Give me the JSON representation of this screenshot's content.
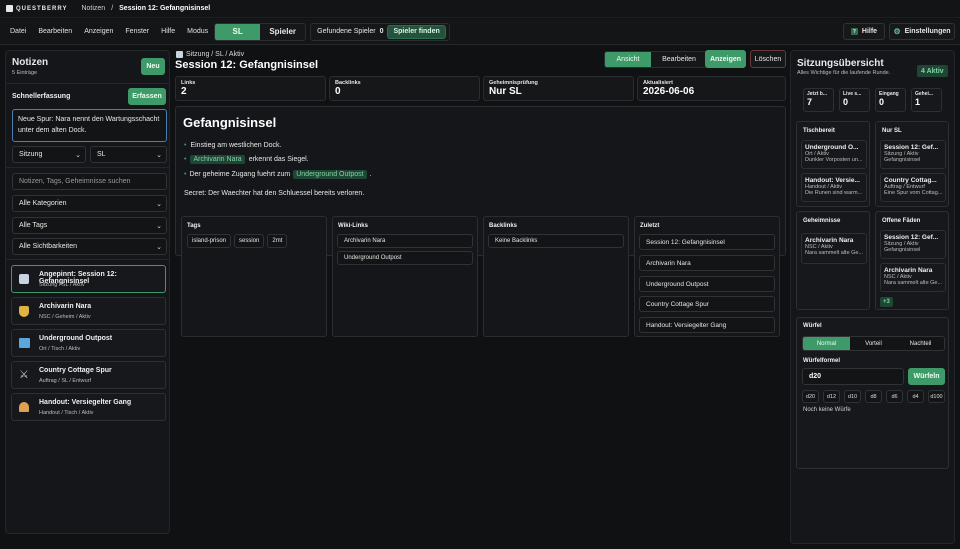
{
  "app": {
    "brand": "QUESTBERRY",
    "crumb_root": "Notizen",
    "crumb_sep": "/",
    "crumb_current": "Session 12: Gefangnisinsel"
  },
  "menubar": {
    "items": [
      "Datei",
      "Bearbeiten",
      "Anzeigen",
      "Fenster",
      "Hilfe",
      "Modus"
    ],
    "mode_sl": "SL",
    "mode_player": "Spieler",
    "found_label": "Gefundene Spieler",
    "found_count": "0",
    "find_button": "Spieler finden",
    "help_button": "Hilfe",
    "settings_button": "Einstellungen"
  },
  "notes": {
    "title": "Notizen",
    "count": "5 Einträge",
    "new_button": "Neu",
    "quick_label": "Schnellerfassung",
    "capture_button": "Erfassen",
    "quick_text": "Neue Spur: Nara nennt den Wartungsschacht unter dem alten Dock.",
    "type_select": "Sitzung",
    "vis_select": "SL",
    "search_placeholder": "Notizen, Tags, Geheimnisse suchen",
    "filter_category": "Alle Kategorien",
    "filter_tags": "Alle Tags",
    "filter_visibility": "Alle Sichtbarkeiten",
    "items": [
      {
        "title": "Angepinnt: Session 12: Gefangnisinsel",
        "meta": "Sitzung / SL / Aktiv",
        "icon": "calendar-icon",
        "color": "#c7d3e0"
      },
      {
        "title": "Archivarin Nara",
        "meta": "NSC / Geheim / Aktiv",
        "icon": "shield-icon",
        "color": "#e3b341"
      },
      {
        "title": "Underground Outpost",
        "meta": "Ort / Tisch / Aktiv",
        "icon": "map-icon",
        "color": "#5aa7e0"
      },
      {
        "title": "Country Cottage Spur",
        "meta": "Auftrag / SL / Entwurf",
        "icon": "crossed-swords-icon",
        "color": "#d0d0d0"
      },
      {
        "title": "Handout: Versiegelter Gang",
        "meta": "Handout / Tisch / Aktiv",
        "icon": "bell-icon",
        "color": "#e0a050"
      }
    ]
  },
  "detail": {
    "path": "Sitzung / SL / Aktiv",
    "title": "Session 12: Gefangnisinsel",
    "tab_view": "Ansicht",
    "tab_edit": "Bearbeiten",
    "show_button": "Anzeigen",
    "delete_button": "Löschen",
    "stats": [
      {
        "label": "Links",
        "value": "2"
      },
      {
        "label": "Backlinks",
        "value": "0"
      },
      {
        "label": "Geheimnisprüfung",
        "value": "Nur SL"
      },
      {
        "label": "Aktualisiert",
        "value": "2026-06-06"
      }
    ],
    "heading": "Gefangnisinsel",
    "bullet1": "Einstieg am westlichen Dock.",
    "chip1": "Archivarin Nara",
    "bullet2_after": "erkennt das Siegel.",
    "bullet3_before": "Der geheime Zugang fuehrt zum",
    "chip2": "Underground Outpost",
    "bullet3_after": ".",
    "secret": "Secret: Der Waechter hat den Schluessel bereits verloren.",
    "tags_title": "Tags",
    "tags": [
      "island-prison",
      "session",
      "2mt"
    ],
    "wiki_title": "Wiki-Links",
    "wiki": [
      "Archivarin Nara",
      "Underground Outpost"
    ],
    "back_title": "Backlinks",
    "back": [
      "Keine Backlinks"
    ],
    "recent_title": "Zuletzt",
    "recent": [
      "Session 12: Gefangnisinsel",
      "Archivarin Nara",
      "Underground Outpost",
      "Country Cottage Spur",
      "Handout: Versiegelter Gang"
    ]
  },
  "overview": {
    "title": "Sitzungsübersicht",
    "subtitle": "Alles Wichtige für die laufende Runde.",
    "badge": "4 Aktiv",
    "stats": [
      {
        "label": "Jetzt b...",
        "value": "7"
      },
      {
        "label": "Live s...",
        "value": "0"
      },
      {
        "label": "Eingang",
        "value": "0"
      },
      {
        "label": "Gehei...",
        "value": "1"
      }
    ],
    "table_title": "Tischbereit",
    "table": [
      {
        "title": "Underground O...",
        "l1": "Ort / Aktiv",
        "l2": "Dunkler Vorposten un..."
      },
      {
        "title": "Handout: Versie...",
        "l1": "Handout / Aktiv",
        "l2": "Die Runen sind warm..."
      }
    ],
    "sl_title": "Nur SL",
    "sl": [
      {
        "title": "Session 12: Gef...",
        "l1": "Sitzung / Aktiv",
        "l2": "Gefangnisinsel"
      },
      {
        "title": "Country Cottag...",
        "l1": "Auftrag / Entwurf",
        "l2": "Eine Spur vom Cottag..."
      }
    ],
    "secret_title": "Geheimnisse",
    "secret": [
      {
        "title": "Archivarin Nara",
        "l1": "NSC / Aktiv",
        "l2": "Nara sammelt alte Ge..."
      }
    ],
    "open_title": "Offene Fäden",
    "open": [
      {
        "title": "Session 12: Gef...",
        "l1": "Sitzung / Aktiv",
        "l2": "Gefangnisinsel"
      },
      {
        "title": "Archivarin Nara",
        "l1": "NSC / Aktiv",
        "l2": "Nara sammelt alte Ge..."
      }
    ],
    "more": "+3",
    "dice_title": "Würfel",
    "dice_modes": [
      "Normal",
      "Vorteil",
      "Nachteil"
    ],
    "formula_label": "Würfelformel",
    "formula_value": "d20",
    "roll_button": "Würfeln",
    "dice": [
      "d20",
      "d12",
      "d10",
      "d8",
      "d6",
      "d4",
      "d100"
    ],
    "no_rolls": "Noch keine Würfe"
  },
  "colors": {
    "accent": "#3f9a6a",
    "chip_bg": "#1f4634",
    "chip_text": "#7fd3a3"
  }
}
